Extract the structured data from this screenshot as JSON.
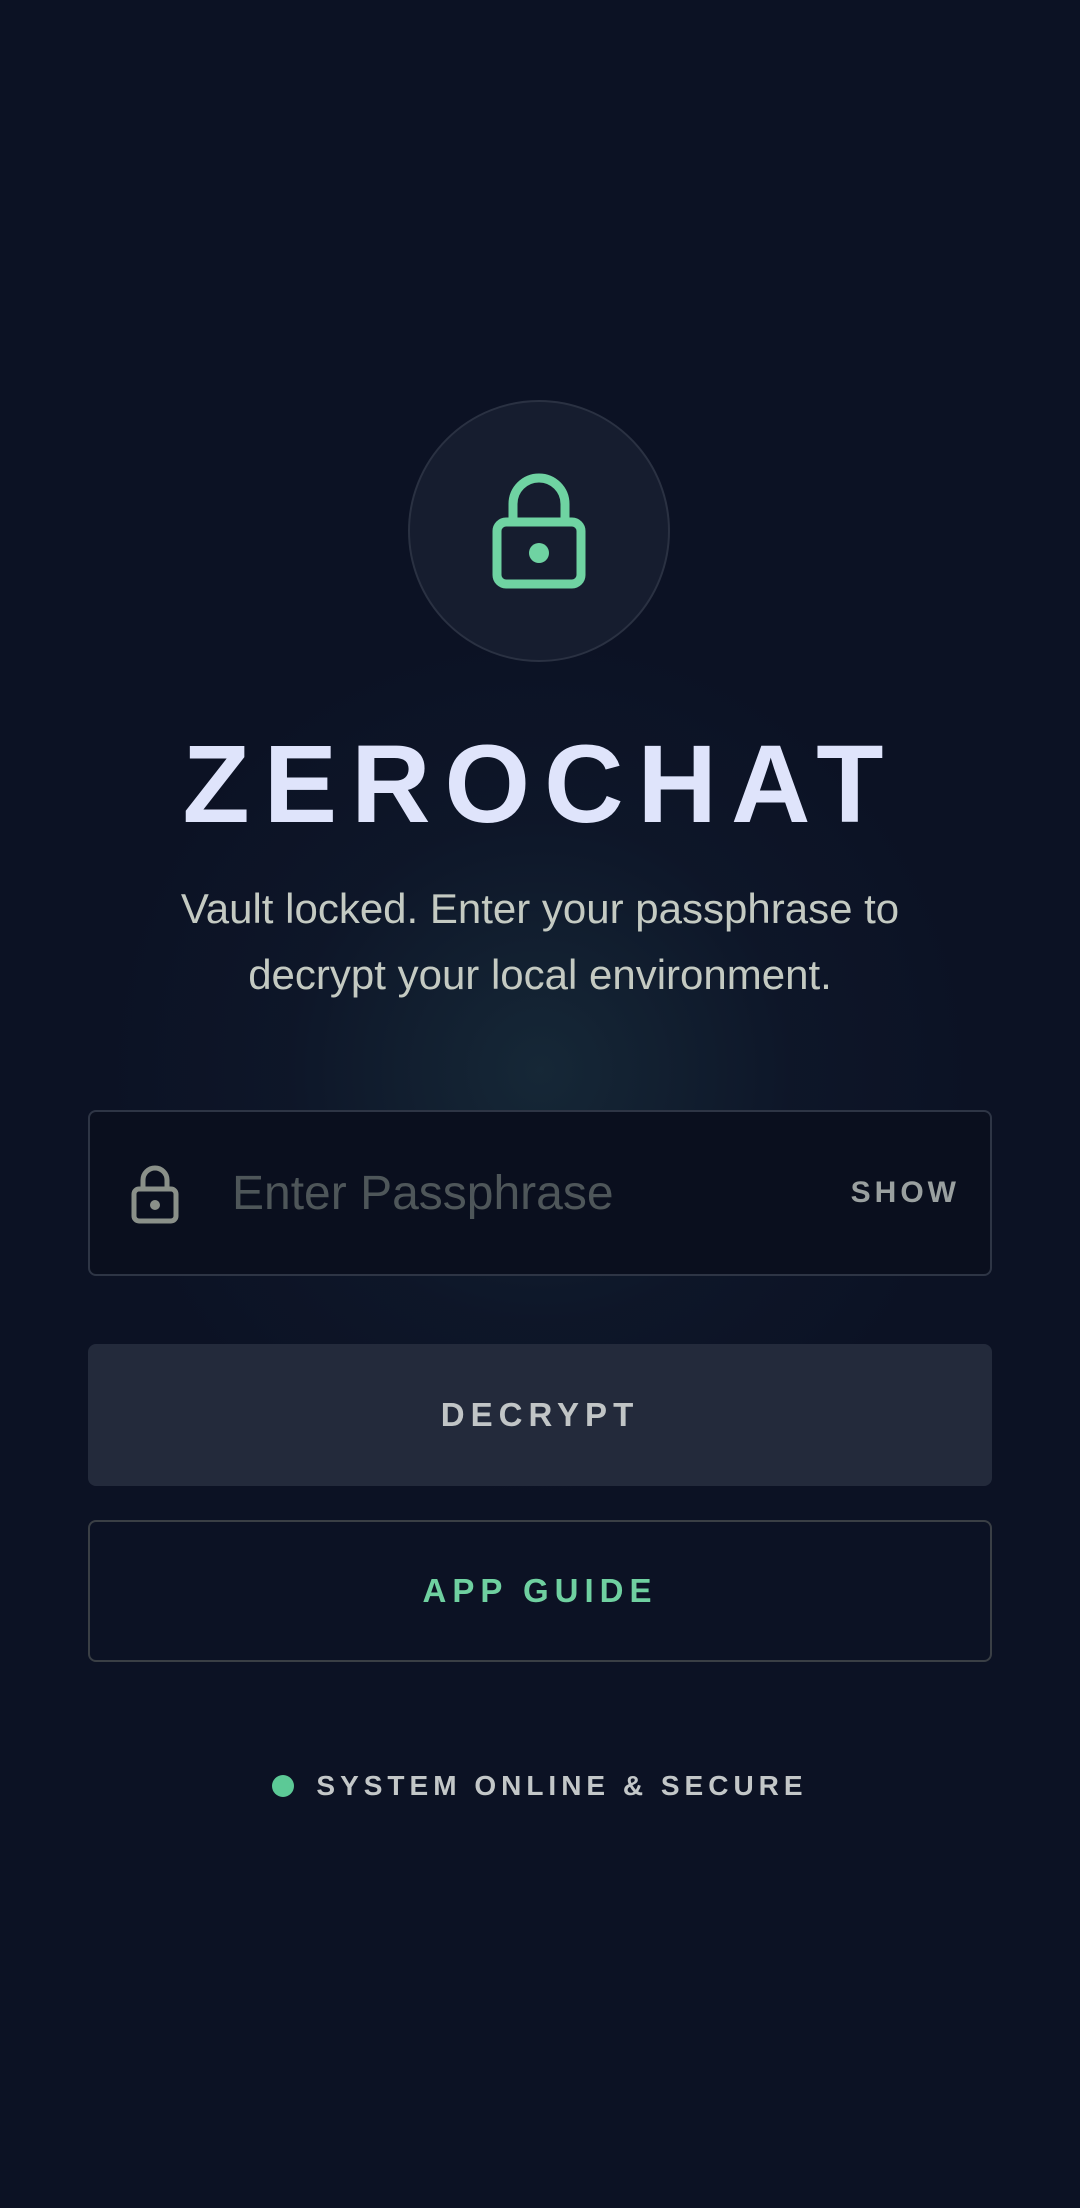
{
  "app": {
    "title": "ZEROCHAT",
    "subtitle": "Vault locked. Enter your passphrase to decrypt your local environment."
  },
  "passphrase": {
    "placeholder": "Enter Passphrase",
    "value": "",
    "show_label": "SHOW"
  },
  "actions": {
    "decrypt_label": "DECRYPT",
    "guide_label": "APP GUIDE"
  },
  "status": {
    "text": "SYSTEM ONLINE & SECURE",
    "dot_color": "#5cc996"
  },
  "icons": {
    "header_icon": "lock-icon",
    "field_icon": "lock-icon"
  },
  "colors": {
    "background": "#0c1224",
    "accent": "#6fd0a0",
    "title": "#dfe4fb"
  }
}
